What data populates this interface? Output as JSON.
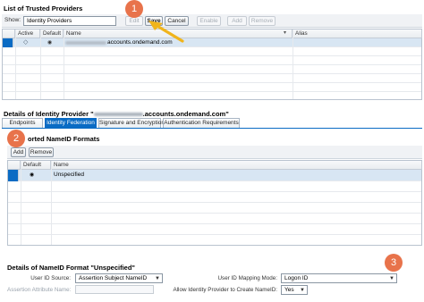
{
  "trusted_providers": {
    "title": "List of Trusted Providers",
    "show_label": "Show:",
    "show_value": "Identity Providers",
    "buttons": {
      "edit": "Edit",
      "save": "Save",
      "cancel": "Cancel",
      "enable": "Enable",
      "add": "Add",
      "remove": "Remove"
    },
    "columns": [
      "Active",
      "Default",
      "Name",
      "Alias"
    ],
    "rows": [
      {
        "name": "accounts.ondemand.com"
      }
    ]
  },
  "idp_details": {
    "title_prefix": "Details of Identity Provider \"",
    "title_suffix": ".accounts.ondemand.com\"",
    "tabs": [
      "Endpoints",
      "Identity Federation",
      "Signature and Encryption",
      "Authentication Requirements"
    ],
    "active_tab": "Identity Federation",
    "supported_title": "orted NameID Formats",
    "buttons": {
      "add": "Add",
      "remove": "Remove"
    },
    "columns": [
      "Default",
      "Name"
    ],
    "rows": [
      {
        "name": "Unspecified"
      }
    ]
  },
  "nameid_details": {
    "title": "Details of NameID Format \"Unspecified\"",
    "user_id_source_label": "User ID Source:",
    "user_id_source_value": "Assertion Subject NameID",
    "assertion_attribute_label": "Assertion Attribute Name:",
    "user_id_mapping_label": "User ID Mapping Mode:",
    "user_id_mapping_value": "Logon ID",
    "allow_create_label": "Allow Identity Provider to Create NameID:",
    "allow_create_value": "Yes"
  },
  "callouts": [
    "1",
    "2",
    "3"
  ],
  "colors": {
    "accent": "#0a6bc4",
    "callout": "#e8734b",
    "arrow": "#f0b41c"
  }
}
